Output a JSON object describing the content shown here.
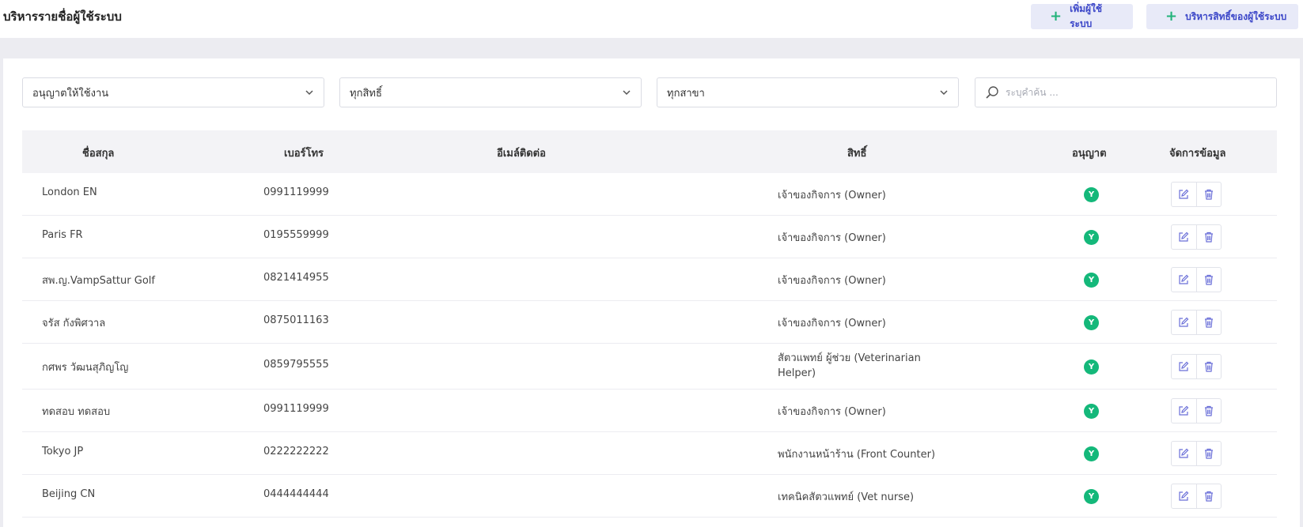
{
  "header": {
    "title": "บริหารรายชื่อผู้ใช้ระบบ",
    "add_user_label": "เพิ่มผู้ใช้ระบบ",
    "manage_permissions_label": "บริหารสิทธิ์ของผู้ใช้ระบบ"
  },
  "filters": {
    "status": "อนุญาตให้ใช้งาน",
    "role": "ทุกสิทธิ์",
    "branch": "ทุกสาขา",
    "search_placeholder": "ระบุคำค้น ..."
  },
  "table": {
    "columns": [
      "ชื่อสกุล",
      "เบอร์โทร",
      "อีเมล์ติดต่อ",
      "สิทธิ์",
      "อนุญาต",
      "จัดการข้อมูล"
    ],
    "rows": [
      {
        "name": "London EN",
        "phone": "0991119999",
        "email": "",
        "role": "เจ้าของกิจการ (Owner)",
        "allowed": "Y"
      },
      {
        "name": "Paris FR",
        "phone": "0195559999",
        "email": "",
        "role": "เจ้าของกิจการ (Owner)",
        "allowed": "Y"
      },
      {
        "name": "สพ.ญ.VampSattur Golf",
        "phone": "0821414955",
        "email": "",
        "role": "เจ้าของกิจการ (Owner)",
        "allowed": "Y"
      },
      {
        "name": "จรัส กังพิศวาล",
        "phone": "0875011163",
        "email": "",
        "role": "เจ้าของกิจการ (Owner)",
        "allowed": "Y"
      },
      {
        "name": "กศพร วัฒนสุภิญโญ",
        "phone": "0859795555",
        "email": "",
        "role": "สัตวแพทย์ ผู้ช่วย (Veterinarian Helper)",
        "allowed": "Y"
      },
      {
        "name": "ทดสอบ ทดสอบ",
        "phone": "0991119999",
        "email": "",
        "role": "เจ้าของกิจการ (Owner)",
        "allowed": "Y"
      },
      {
        "name": "Tokyo JP",
        "phone": "0222222222",
        "email": "",
        "role": "พนักงานหน้าร้าน (Front Counter)",
        "allowed": "Y"
      },
      {
        "name": "Beijing CN",
        "phone": "0444444444",
        "email": "",
        "role": "เทคนิคสัตวแพทย์ (Vet nurse)",
        "allowed": "Y"
      }
    ]
  },
  "colors": {
    "accent": "#3b46c8",
    "success": "#14b87a",
    "plus": "#22b37a",
    "button_bg": "#e8eaf8",
    "header_bg": "#f3f3f6",
    "band_bg": "#ececf1"
  },
  "icons": {
    "plus": "plus-icon",
    "chevron": "chevron-down-icon",
    "search": "search-icon",
    "edit": "edit-icon",
    "delete": "trash-icon"
  }
}
